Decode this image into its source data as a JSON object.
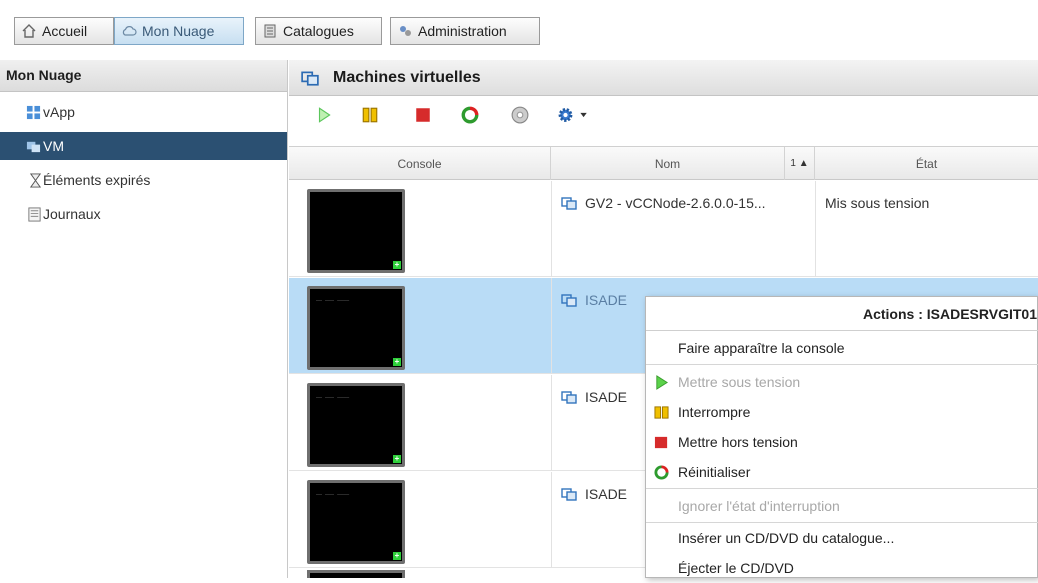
{
  "top_tabs": [
    {
      "label": "Accueil",
      "icon": "home-icon",
      "active": false
    },
    {
      "label": "Mon Nuage",
      "icon": "cloud-icon",
      "active": true
    },
    {
      "label": "Catalogues",
      "icon": "catalog-icon",
      "active": false
    },
    {
      "label": "Administration",
      "icon": "admin-icon",
      "active": false
    }
  ],
  "sidebar": {
    "title": "Mon Nuage",
    "items": [
      {
        "label": "vApp",
        "icon": "vapp-icon",
        "selected": false
      },
      {
        "label": "VM",
        "icon": "vm-icon",
        "selected": true
      },
      {
        "label": "Éléments expirés",
        "icon": "hourglass-icon",
        "selected": false
      },
      {
        "label": "Journaux",
        "icon": "log-icon",
        "selected": false
      }
    ]
  },
  "main": {
    "title": "Machines virtuelles",
    "toolbar": [
      "play-icon",
      "pause-icon",
      "stop-icon",
      "reset-icon",
      "disc-icon",
      "gear-menu-icon"
    ]
  },
  "grid": {
    "columns": {
      "console": "Console",
      "name": "Nom",
      "sort": "1 ▲",
      "state": "État"
    },
    "rows": [
      {
        "name": "GV2 - vCCNode-2.6.0.0-15...",
        "state": "Mis sous tension",
        "selected": false,
        "screen_text": ""
      },
      {
        "name": "ISADE",
        "state": "",
        "selected": true,
        "screen_text": "__ ___ ____"
      },
      {
        "name": "ISADE",
        "state": "",
        "selected": false,
        "screen_text": "__ ___ ____"
      },
      {
        "name": "ISADE",
        "state": "",
        "selected": false,
        "screen_text": "__ ___ ____"
      }
    ]
  },
  "context_menu": {
    "title": "Actions : ISADESRVGIT01",
    "items": [
      {
        "label": "Faire apparaître la console",
        "icon": "",
        "disabled": false
      },
      {
        "label": "Mettre sous tension",
        "icon": "play-icon",
        "disabled": true
      },
      {
        "label": "Interrompre",
        "icon": "pause-icon",
        "disabled": false
      },
      {
        "label": "Mettre hors tension",
        "icon": "stop-icon",
        "disabled": false
      },
      {
        "label": "Réinitialiser",
        "icon": "reset-icon",
        "disabled": false
      },
      {
        "label": "Ignorer l'état d'interruption",
        "icon": "",
        "disabled": true
      },
      {
        "label": "Insérer un CD/DVD du catalogue...",
        "icon": "",
        "disabled": false
      },
      {
        "label": "Éjecter le CD/DVD",
        "icon": "",
        "disabled": false
      }
    ]
  },
  "colors": {
    "selected_sidebar": "#2b5072",
    "selected_row": "#b9dcf6",
    "accent_green": "#4bc94b",
    "accent_red": "#d93030",
    "accent_yellow": "#f0b800"
  }
}
